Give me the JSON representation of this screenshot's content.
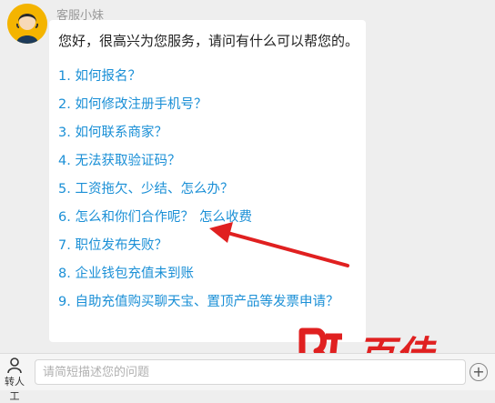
{
  "agent": {
    "name": "客服小妹",
    "avatar_icon": "customer-service-agent-avatar-icon"
  },
  "message": {
    "greeting": "您好，很高兴为您服务，请问有什么可以帮您的。",
    "faq": [
      {
        "label": "1. 如何报名？"
      },
      {
        "label": "2. 如何修改注册手机号？"
      },
      {
        "label": "3. 如何联系商家？"
      },
      {
        "label": "4. 无法获取验证码？"
      },
      {
        "label": "5. 工资拖欠、少结、怎么办？"
      },
      {
        "label": "6. 怎么和你们合作呢？",
        "extra": "怎么收费"
      },
      {
        "label": "7. 职位发布失败？"
      },
      {
        "label": "8. 企业钱包充值未到账"
      },
      {
        "label": "9. 自助充值购买聊天宝、置顶产品等发票申请？"
      }
    ]
  },
  "annotation": {
    "arrow_color": "#e02020"
  },
  "watermark": {
    "text": "百佳",
    "color": "#e02020"
  },
  "input_bar": {
    "transfer_label": "转人工",
    "placeholder": "请简短描述您的问题",
    "plus_symbol": "+"
  },
  "colors": {
    "link": "#1a8fd6",
    "bubble": "#ffffff",
    "background": "#eeeeee"
  }
}
